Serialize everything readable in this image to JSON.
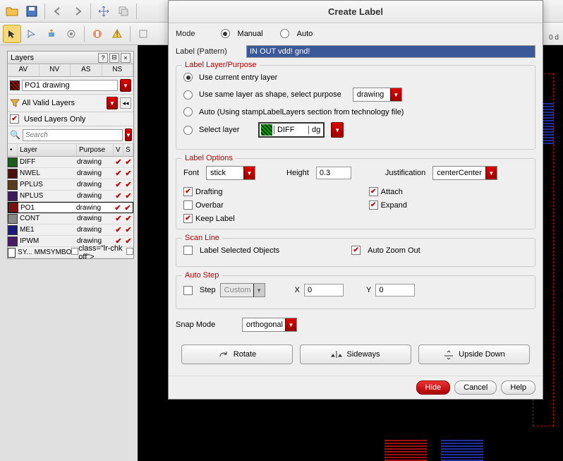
{
  "panel": {
    "title": "Layers",
    "tabs": [
      "AV",
      "NV",
      "AS",
      "NS"
    ],
    "current_layer": "PO1 drawing",
    "filter_label": "All Valid Layers",
    "used_only_label": "Used Layers Only",
    "search_placeholder": "Search",
    "columns": [
      "Layer",
      "Purpose",
      "V",
      "S"
    ],
    "rows": [
      {
        "name": "DIFF",
        "purpose": "drawing",
        "v": true,
        "s": true,
        "color": "#1a5c1a"
      },
      {
        "name": "NWEL",
        "purpose": "drawing",
        "v": true,
        "s": true,
        "color": "#4a1010"
      },
      {
        "name": "PPLUS",
        "purpose": "drawing",
        "v": true,
        "s": true,
        "color": "#5a3a1a"
      },
      {
        "name": "NPLUS",
        "purpose": "drawing",
        "v": true,
        "s": true,
        "color": "#3a1a5a"
      },
      {
        "name": "PO1",
        "purpose": "drawing",
        "v": true,
        "s": true,
        "color": "#7a1010",
        "sel": true
      },
      {
        "name": "CONT",
        "purpose": "drawing",
        "v": true,
        "s": true,
        "color": "#888"
      },
      {
        "name": "ME1",
        "purpose": "drawing",
        "v": true,
        "s": true,
        "color": "#1a1a7a"
      },
      {
        "name": "IPWM",
        "purpose": "drawing",
        "v": true,
        "s": true,
        "color": "#4a1a6a"
      },
      {
        "name": "SY...",
        "purpose": "MMSYMBOL",
        "v": false,
        "s": false,
        "color": "#fff"
      }
    ]
  },
  "coord": "0 d",
  "dialog": {
    "title": "Create Label",
    "mode_label": "Mode",
    "mode_manual": "Manual",
    "mode_auto": "Auto",
    "pattern_label": "Label (Pattern)",
    "pattern_value": "IN OUT vdd! gnd!",
    "layer": {
      "legend": "Label Layer/Purpose",
      "opt1": "Use current entry layer",
      "opt2": "Use same layer as shape, select purpose",
      "opt2_combo": "drawing",
      "opt3": "Auto (Using stampLabelLayers section from technology file)",
      "opt4": "Select layer",
      "opt4_layer": "DIFF",
      "opt4_purpose": "dg"
    },
    "options": {
      "legend": "Label Options",
      "font_label": "Font",
      "font_value": "stick",
      "height_label": "Height",
      "height_value": "0.3",
      "just_label": "Justification",
      "just_value": "centerCenter",
      "drafting": "Drafting",
      "overbar": "Overbar",
      "keep": "Keep Label",
      "attach": "Attach",
      "expand": "Expand"
    },
    "scan": {
      "legend": "Scan Line",
      "sel_objs": "Label Selected Objects",
      "zoom": "Auto Zoom Out"
    },
    "autostep": {
      "legend": "Auto Step",
      "step": "Step",
      "custom": "Custom",
      "x_label": "X",
      "x_val": "0",
      "y_label": "Y",
      "y_val": "0"
    },
    "snap_label": "Snap Mode",
    "snap_value": "orthogonal",
    "rotate": "Rotate",
    "sideways": "Sideways",
    "upside": "Upside Down",
    "hide": "Hide",
    "cancel": "Cancel",
    "help": "Help"
  }
}
